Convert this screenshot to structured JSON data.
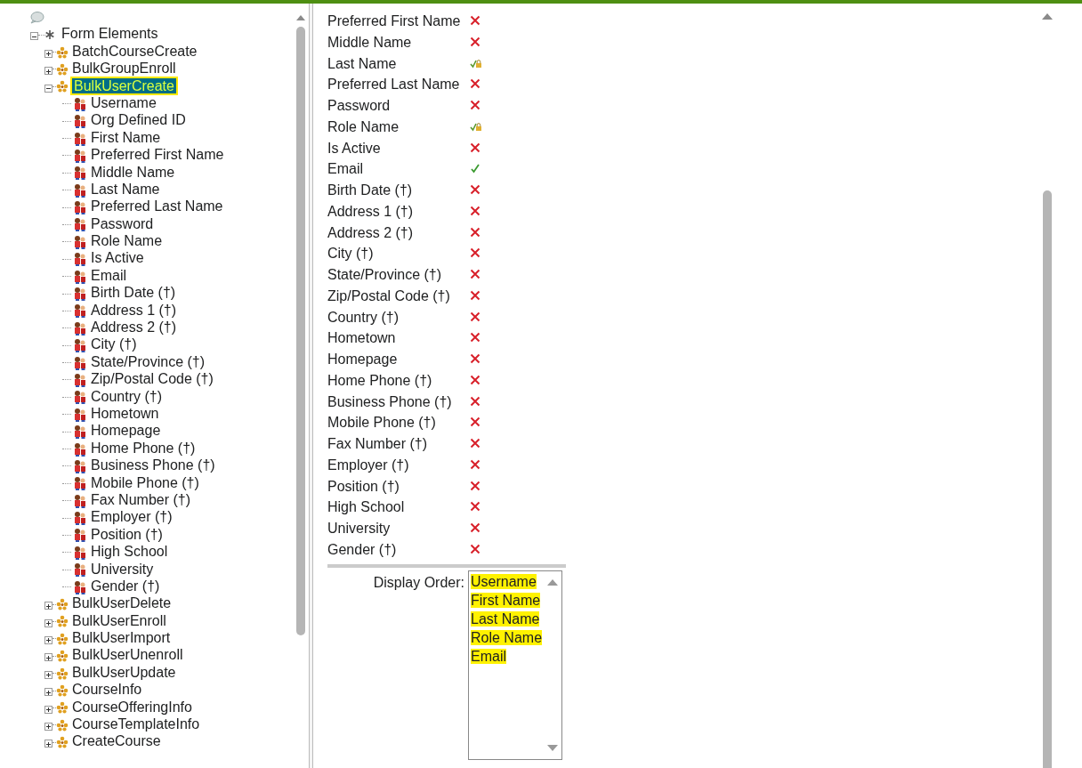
{
  "tree": {
    "label": "Form Elements",
    "expanded": true,
    "children": [
      {
        "label": "BatchCourseCreate",
        "expanded": false,
        "selected": false
      },
      {
        "label": "BulkGroupEnroll",
        "expanded": false,
        "selected": false
      },
      {
        "label": "BulkUserCreate",
        "expanded": true,
        "selected": true,
        "children": [
          {
            "label": "Username"
          },
          {
            "label": "Org Defined ID"
          },
          {
            "label": "First Name"
          },
          {
            "label": "Preferred First Name"
          },
          {
            "label": "Middle Name"
          },
          {
            "label": "Last Name"
          },
          {
            "label": "Preferred Last Name"
          },
          {
            "label": "Password"
          },
          {
            "label": "Role Name"
          },
          {
            "label": "Is Active"
          },
          {
            "label": "Email"
          },
          {
            "label": "Birth Date (†)"
          },
          {
            "label": "Address 1 (†)"
          },
          {
            "label": "Address 2 (†)"
          },
          {
            "label": "City (†)"
          },
          {
            "label": "State/Province (†)"
          },
          {
            "label": "Zip/Postal Code (†)"
          },
          {
            "label": "Country (†)"
          },
          {
            "label": "Hometown"
          },
          {
            "label": "Homepage"
          },
          {
            "label": "Home Phone (†)"
          },
          {
            "label": "Business Phone (†)"
          },
          {
            "label": "Mobile Phone (†)"
          },
          {
            "label": "Fax Number (†)"
          },
          {
            "label": "Employer (†)"
          },
          {
            "label": "Position (†)"
          },
          {
            "label": "High School"
          },
          {
            "label": "University"
          },
          {
            "label": "Gender (†)"
          }
        ]
      },
      {
        "label": "BulkUserDelete",
        "expanded": false,
        "selected": false
      },
      {
        "label": "BulkUserEnroll",
        "expanded": false,
        "selected": false
      },
      {
        "label": "BulkUserImport",
        "expanded": false,
        "selected": false
      },
      {
        "label": "BulkUserUnenroll",
        "expanded": false,
        "selected": false
      },
      {
        "label": "BulkUserUpdate",
        "expanded": false,
        "selected": false
      },
      {
        "label": "CourseInfo",
        "expanded": false,
        "selected": false
      },
      {
        "label": "CourseOfferingInfo",
        "expanded": false,
        "selected": false
      },
      {
        "label": "CourseTemplateInfo",
        "expanded": false,
        "selected": false
      },
      {
        "label": "CreateCourse",
        "expanded": false,
        "selected": false
      }
    ]
  },
  "fields": [
    {
      "label": "Preferred First Name",
      "kind": "excluded"
    },
    {
      "label": "Middle Name",
      "kind": "excluded"
    },
    {
      "label": "Last Name",
      "kind": "locked"
    },
    {
      "label": "Preferred Last Name",
      "kind": "excluded"
    },
    {
      "label": "Password",
      "kind": "excluded"
    },
    {
      "label": "Role Name",
      "kind": "locked"
    },
    {
      "label": "Is Active",
      "kind": "excluded"
    },
    {
      "label": "Email",
      "kind": "included"
    },
    {
      "label": "Birth Date (†)",
      "kind": "excluded"
    },
    {
      "label": "Address 1 (†)",
      "kind": "excluded"
    },
    {
      "label": "Address 2 (†)",
      "kind": "excluded"
    },
    {
      "label": "City (†)",
      "kind": "excluded"
    },
    {
      "label": "State/Province (†)",
      "kind": "excluded"
    },
    {
      "label": "Zip/Postal Code (†)",
      "kind": "excluded"
    },
    {
      "label": "Country (†)",
      "kind": "excluded"
    },
    {
      "label": "Hometown",
      "kind": "excluded"
    },
    {
      "label": "Homepage",
      "kind": "excluded"
    },
    {
      "label": "Home Phone (†)",
      "kind": "excluded"
    },
    {
      "label": "Business Phone (†)",
      "kind": "excluded"
    },
    {
      "label": "Mobile Phone (†)",
      "kind": "excluded"
    },
    {
      "label": "Fax Number (†)",
      "kind": "excluded"
    },
    {
      "label": "Employer (†)",
      "kind": "excluded"
    },
    {
      "label": "Position (†)",
      "kind": "excluded"
    },
    {
      "label": "High School",
      "kind": "excluded"
    },
    {
      "label": "University",
      "kind": "excluded"
    },
    {
      "label": "Gender (†)",
      "kind": "excluded"
    }
  ],
  "display_order": {
    "label": "Display Order:",
    "items": [
      {
        "label": "Username",
        "highlighted": true
      },
      {
        "label": "First Name",
        "highlighted": true
      },
      {
        "label": "Last Name",
        "highlighted": true
      },
      {
        "label": "Role Name",
        "highlighted": true
      },
      {
        "label": "Email",
        "highlighted": true
      }
    ]
  }
}
